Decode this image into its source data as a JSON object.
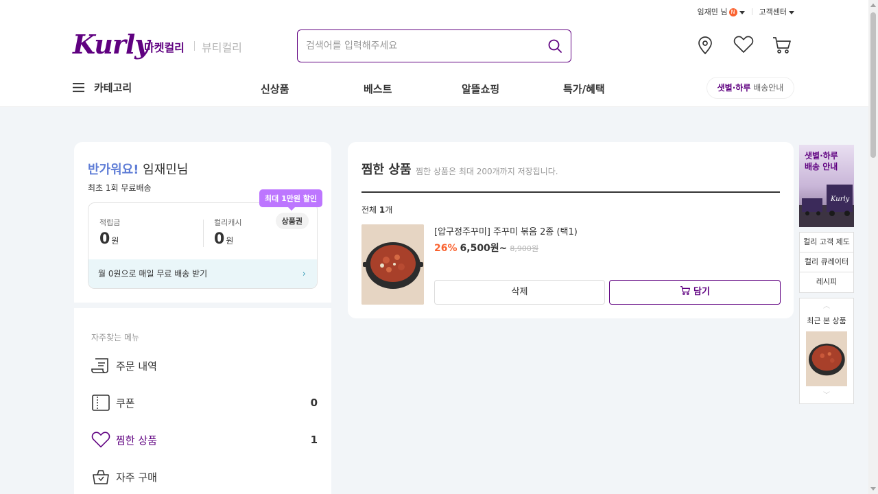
{
  "topbar": {
    "user": "임재민 님",
    "badge": "N",
    "support": "고객센터"
  },
  "brand": {
    "logo": "Kurly",
    "market": "마켓컬리",
    "beauty": "뷰티컬리"
  },
  "search": {
    "placeholder": "검색어를 입력해주세요",
    "value": ""
  },
  "header_icons": [
    "location-icon",
    "heart-icon",
    "cart-icon"
  ],
  "nav": {
    "category": "카테고리",
    "items": [
      "신상품",
      "베스트",
      "알뜰쇼핑",
      "특가/혜택"
    ],
    "delivery_bold": "샛별·하루",
    "delivery_rest": " 배송안내"
  },
  "profile": {
    "greeting_hi": "반가워요!",
    "greeting_name": " 임재민님",
    "sub": "최초 1회 무료배송",
    "bubble": "최대 1만원 할인",
    "points_label": "적립금",
    "points_value": "0",
    "cash_label": "컬리캐시",
    "cash_value": "0",
    "won": "원",
    "coupon_chip": "상품권",
    "promo": "월 0원으로 매일 무료 배송 받기"
  },
  "menu": {
    "title": "자주찾는 메뉴",
    "items": [
      {
        "label": "주문 내역",
        "count": ""
      },
      {
        "label": "쿠폰",
        "count": "0"
      },
      {
        "label": "찜한 상품",
        "count": "1"
      },
      {
        "label": "자주 구매",
        "count": ""
      }
    ]
  },
  "wishlist": {
    "title": "찜한 상품",
    "desc": "찜한 상품은 최대 200개까지 저장됩니다.",
    "count_prefix": "전체 ",
    "count": "1",
    "count_suffix": "개",
    "product": {
      "name": "[압구정주꾸미] 주꾸미 볶음 2종 (택1)",
      "rate": "26%",
      "price": "6,500원~",
      "original": "8,900원"
    },
    "delete_label": "삭제",
    "cart_label": "담기"
  },
  "side": {
    "banner": "샛별·하루\n배송 안내",
    "banner_logo": "Kurly",
    "links": [
      "컬리 고객 제도",
      "컬리 큐레이터",
      "레시피"
    ],
    "recent_title": "최근 본 상품"
  },
  "colors": {
    "brand": "#5f0080",
    "accent": "#fa622f",
    "bubble": "#bd76ff"
  }
}
